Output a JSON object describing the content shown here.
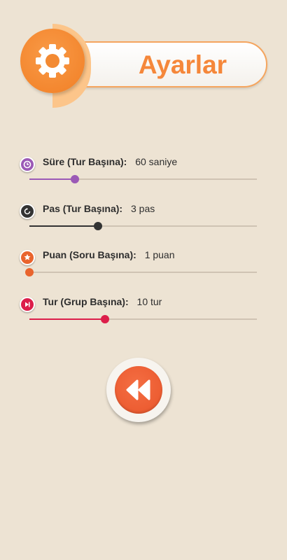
{
  "header": {
    "title": "Ayarlar",
    "icon": "gear-icon"
  },
  "settings": [
    {
      "label": "Süre (Tur Başına):",
      "value": "60 saniye",
      "color": "#9b59b6",
      "level": 0.2,
      "icon": "clock-icon"
    },
    {
      "label": "Pas (Tur Başına):",
      "value": "3 pas",
      "color": "#333333",
      "level": 0.3,
      "icon": "refresh-icon"
    },
    {
      "label": "Puan (Soru Başına):",
      "value": "1 puan",
      "color": "#e9642d",
      "level": 0.0,
      "icon": "star-icon"
    },
    {
      "label": "Tur (Grup Başına):",
      "value": "10 tur",
      "color": "#dc1e4a",
      "level": 0.333,
      "icon": "skip-icon"
    }
  ],
  "back_button": {
    "icon": "rewind-icon",
    "color": "#ef5f35"
  }
}
